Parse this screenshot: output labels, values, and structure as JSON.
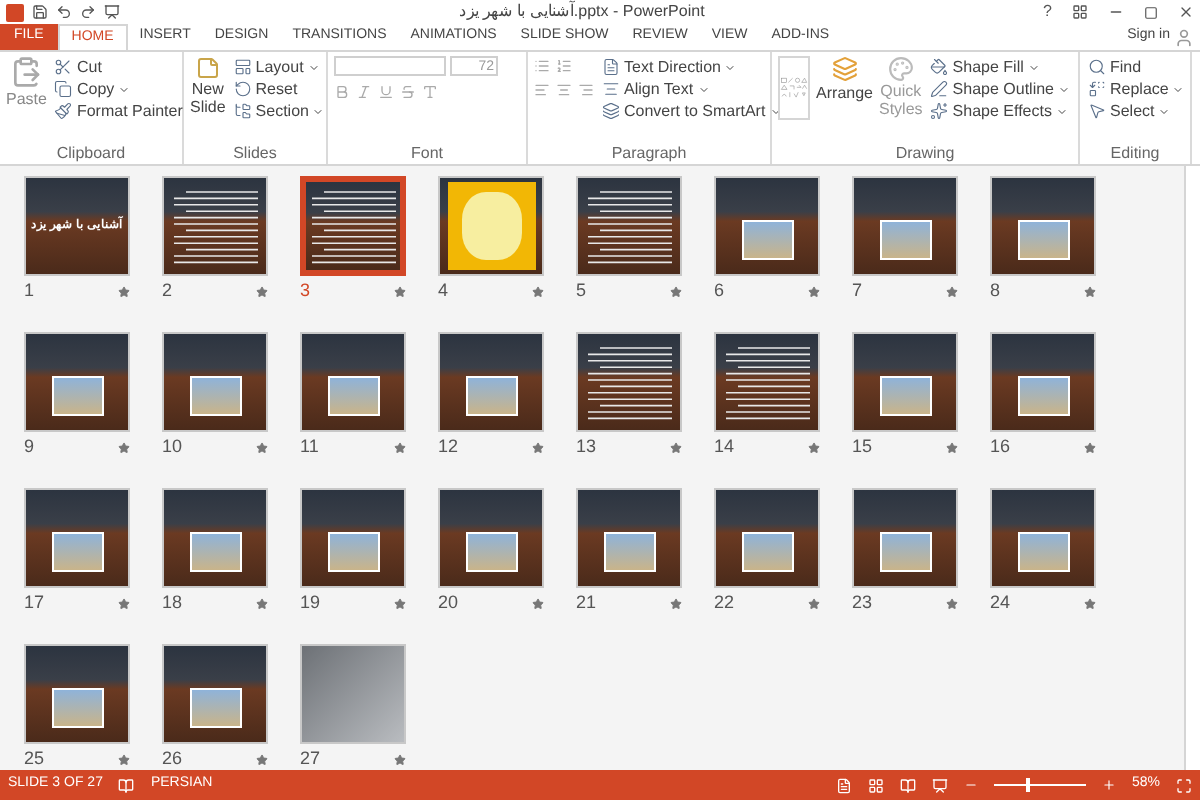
{
  "window": {
    "title": "آشنایی با شهر یزد.pptx - PowerPoint",
    "help": "?",
    "sign_in": "Sign in"
  },
  "tabs": [
    {
      "label": "FILE",
      "kind": "file",
      "selected": false
    },
    {
      "label": "HOME",
      "kind": "tab",
      "selected": true
    },
    {
      "label": "INSERT",
      "kind": "tab",
      "selected": false
    },
    {
      "label": "DESIGN",
      "kind": "tab",
      "selected": false
    },
    {
      "label": "TRANSITIONS",
      "kind": "tab",
      "selected": false
    },
    {
      "label": "ANIMATIONS",
      "kind": "tab",
      "selected": false
    },
    {
      "label": "SLIDE SHOW",
      "kind": "tab",
      "selected": false
    },
    {
      "label": "REVIEW",
      "kind": "tab",
      "selected": false
    },
    {
      "label": "VIEW",
      "kind": "tab",
      "selected": false
    },
    {
      "label": "ADD-INS",
      "kind": "tab",
      "selected": false
    }
  ],
  "ribbon": {
    "clipboard": {
      "label": "Clipboard",
      "paste": "Paste",
      "cut": "Cut",
      "copy": "Copy",
      "format_painter": "Format Painter"
    },
    "slides": {
      "label": "Slides",
      "new_slide": "New Slide",
      "layout": "Layout",
      "reset": "Reset",
      "section": "Section"
    },
    "font": {
      "label": "Font",
      "size": "72"
    },
    "paragraph": {
      "label": "Paragraph",
      "text_direction": "Text Direction",
      "align_text": "Align Text",
      "convert": "Convert to SmartArt"
    },
    "drawing": {
      "label": "Drawing",
      "arrange": "Arrange",
      "quick_styles": "Quick Styles",
      "shape_fill": "Shape Fill",
      "shape_outline": "Shape Outline",
      "shape_effects": "Shape Effects"
    },
    "editing": {
      "label": "Editing",
      "find": "Find",
      "replace": "Replace",
      "select": "Select"
    }
  },
  "slides": [
    {
      "number": "1",
      "kind": "title",
      "title": "آشنایی با شهر یزد",
      "selected": false
    },
    {
      "number": "2",
      "kind": "text",
      "selected": false
    },
    {
      "number": "3",
      "kind": "text",
      "selected": true
    },
    {
      "number": "4",
      "kind": "map",
      "selected": false
    },
    {
      "number": "5",
      "kind": "text",
      "selected": false
    },
    {
      "number": "6",
      "kind": "photo",
      "selected": false
    },
    {
      "number": "7",
      "kind": "photo",
      "selected": false
    },
    {
      "number": "8",
      "kind": "photo",
      "selected": false
    },
    {
      "number": "9",
      "kind": "photo",
      "selected": false
    },
    {
      "number": "10",
      "kind": "photo",
      "selected": false
    },
    {
      "number": "11",
      "kind": "photo",
      "selected": false
    },
    {
      "number": "12",
      "kind": "photo",
      "selected": false
    },
    {
      "number": "13",
      "kind": "text",
      "selected": false
    },
    {
      "number": "14",
      "kind": "text",
      "selected": false
    },
    {
      "number": "15",
      "kind": "photo",
      "selected": false
    },
    {
      "number": "16",
      "kind": "photo",
      "selected": false
    },
    {
      "number": "17",
      "kind": "photo",
      "selected": false
    },
    {
      "number": "18",
      "kind": "photo",
      "selected": false
    },
    {
      "number": "19",
      "kind": "photo",
      "selected": false
    },
    {
      "number": "20",
      "kind": "photo",
      "selected": false
    },
    {
      "number": "21",
      "kind": "photo",
      "selected": false
    },
    {
      "number": "22",
      "kind": "photo",
      "selected": false
    },
    {
      "number": "23",
      "kind": "photo",
      "selected": false
    },
    {
      "number": "24",
      "kind": "photo",
      "selected": false
    },
    {
      "number": "25",
      "kind": "photo",
      "selected": false
    },
    {
      "number": "26",
      "kind": "photo",
      "selected": false
    },
    {
      "number": "27",
      "kind": "laptop",
      "selected": false
    }
  ],
  "status_bar": {
    "slide": "SLIDE 3 OF 27",
    "language": "PERSIAN",
    "zoom": "58%",
    "zoom_slider": {
      "level": 0.35
    }
  }
}
